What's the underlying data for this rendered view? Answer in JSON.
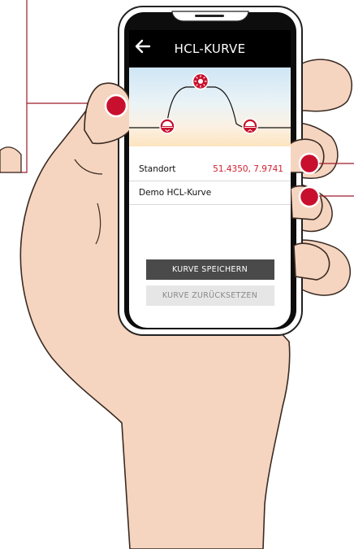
{
  "header": {
    "title": "HCL-KURVE",
    "back_icon": "arrow-left-icon"
  },
  "curve": {
    "icons": [
      "sunrise-icon",
      "sun-noon-icon",
      "sunset-icon"
    ],
    "colors": {
      "marker": "#c8102e",
      "line": "#111111"
    }
  },
  "info": {
    "location_label": "Standort",
    "location_value": "51.4350, 7.9741",
    "curve_name": "Demo HCL-Kurve"
  },
  "actions": {
    "save_label": "KURVE SPEICHERN",
    "reset_label": "KURVE ZURÜCKSETZEN"
  },
  "colors": {
    "accent_red": "#c8102e",
    "value_red": "#d1202f",
    "header_bg": "#000000",
    "save_bg": "#4a4a4a",
    "reset_bg": "#e6e6e6",
    "skin": "#f5d5c0",
    "skin_outline": "#3a2a22",
    "callout_line": "#9e1b2b"
  }
}
